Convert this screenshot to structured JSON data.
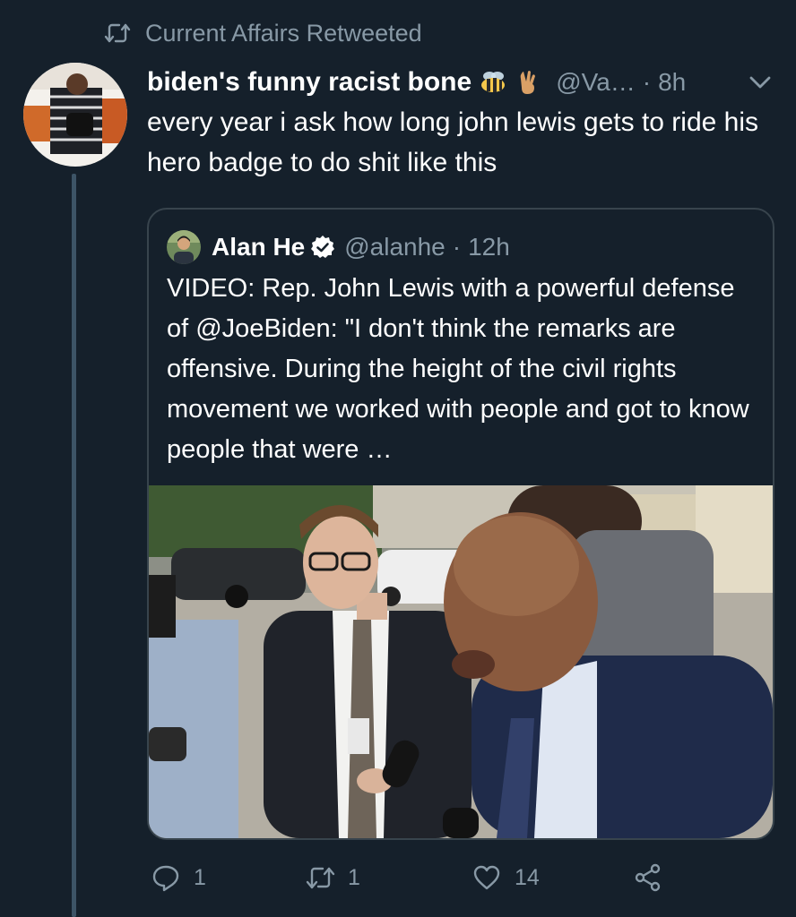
{
  "retweet_context": {
    "text": "Current Affairs Retweeted"
  },
  "tweet": {
    "display_name": "biden's funny racist bone",
    "name_emojis": [
      "bee-emoji",
      "victory-hand-emoji"
    ],
    "handle": "@Va…",
    "separator": "·",
    "time": "8h",
    "text": "every year i ask how long john lewis gets to ride his hero badge to do shit like this"
  },
  "quoted_tweet": {
    "display_name": "Alan He",
    "verified": true,
    "handle": "@alanhe",
    "separator": "·",
    "time": "12h",
    "text": "VIDEO: Rep. John Lewis with a powerful defense of @JoeBiden: \"I don't think the remarks are offensive. During the height of the civil rights movement we worked with people and got to know people that were …"
  },
  "actions": {
    "reply_count": "1",
    "retweet_count": "1",
    "like_count": "14"
  },
  "colors": {
    "background": "#15202b",
    "text": "#ffffff",
    "muted": "#8899a6",
    "border": "#38444d",
    "thread_line": "#3d5466"
  }
}
